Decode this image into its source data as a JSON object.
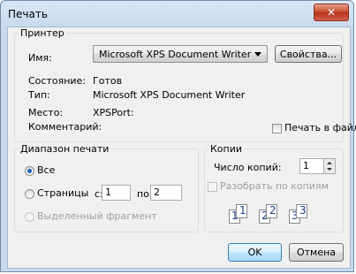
{
  "window": {
    "title": "Печать",
    "close_glyph": "✕"
  },
  "printer": {
    "legend": "Принтер",
    "name_label": "Имя:",
    "name_value": "Microsoft XPS Document Writer",
    "properties_button": "Свойства...",
    "status_label": "Состояние:",
    "status_value": "Готов",
    "type_label": "Тип:",
    "type_value": "Microsoft XPS Document Writer",
    "where_label": "Место:",
    "where_value": "XPSPort:",
    "comment_label": "Комментарий:",
    "print_to_file_label": "Печать в файл",
    "print_to_file_checked": false
  },
  "range": {
    "legend": "Диапазон печати",
    "all_label": "Все",
    "pages_label": "Страницы",
    "from_label": "с:",
    "from_value": "1",
    "to_label": "по:",
    "to_value": "2",
    "selection_label": "Выделенный фрагмент",
    "selected": "all"
  },
  "copies": {
    "legend": "Копии",
    "count_label": "Число копий:",
    "count_value": "1",
    "collate_label": "Разобрать по копиям",
    "collate_checked": false,
    "collate_pages": [
      "1",
      "1",
      "2",
      "2",
      "3",
      "3"
    ]
  },
  "buttons": {
    "ok": "OK",
    "cancel": "Отмена"
  }
}
